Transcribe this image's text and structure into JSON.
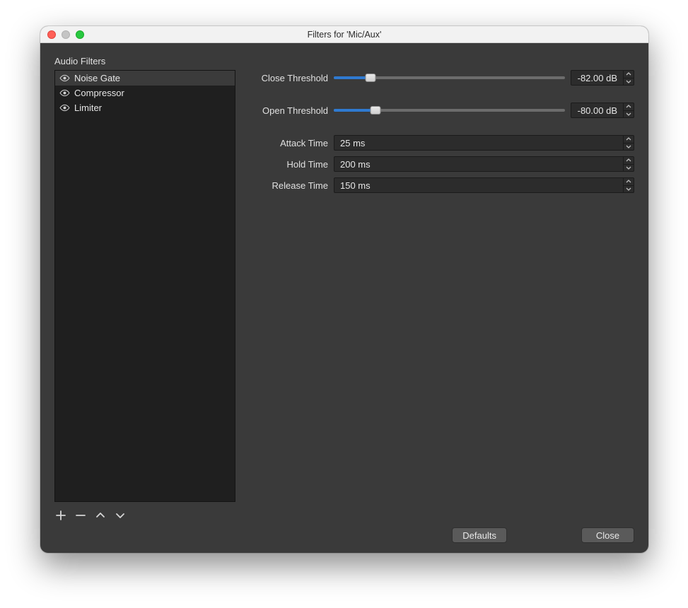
{
  "window": {
    "title": "Filters for 'Mic/Aux'"
  },
  "sidebar": {
    "title": "Audio Filters",
    "items": [
      {
        "label": "Noise Gate",
        "selected": true
      },
      {
        "label": "Compressor",
        "selected": false
      },
      {
        "label": "Limiter",
        "selected": false
      }
    ]
  },
  "props": {
    "close_threshold": {
      "label": "Close Threshold",
      "value": "-82.00 dB",
      "slider_pct": 16
    },
    "open_threshold": {
      "label": "Open Threshold",
      "value": "-80.00 dB",
      "slider_pct": 18
    },
    "attack_time": {
      "label": "Attack Time",
      "value": "25 ms"
    },
    "hold_time": {
      "label": "Hold Time",
      "value": "200 ms"
    },
    "release_time": {
      "label": "Release Time",
      "value": "150 ms"
    }
  },
  "footer": {
    "defaults": "Defaults",
    "close": "Close"
  }
}
